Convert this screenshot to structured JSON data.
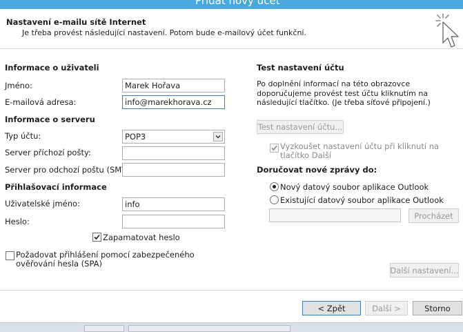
{
  "window": {
    "title": "Přidat nový účet"
  },
  "header": {
    "title": "Nastavení e-mailu sítě Internet",
    "subtitle": "Je třeba provést následující nastavení. Potom bude e-mailový účet funkční."
  },
  "user_info": {
    "heading": "Informace o uživateli",
    "name_label": "Jméno:",
    "name_value": "Marek Hořava",
    "email_label": "E-mailová adresa:",
    "email_value": "info@marekhorava.cz"
  },
  "server_info": {
    "heading": "Informace o serveru",
    "account_type_label": "Typ účtu:",
    "account_type_value": "POP3",
    "incoming_label": "Server příchozí pošty:",
    "incoming_value": "",
    "outgoing_label": "Server pro odchozí poštu (SMTP):",
    "outgoing_value": ""
  },
  "login_info": {
    "heading": "Přihlašovací informace",
    "username_label": "Uživatelské jméno:",
    "username_value": "info",
    "password_label": "Heslo:",
    "password_value": "",
    "remember_label": "Zapamatovat heslo",
    "remember_checked": true,
    "spa_label": "Požadovat přihlášení pomocí zabezpečeného ověřování hesla (SPA)",
    "spa_checked": false
  },
  "test": {
    "heading": "Test nastavení účtu",
    "description": "Po doplnění informací na této obrazovce doporučujeme provést test účtu kliknutím na následující tlačítko. (Je třeba síťové připojení.)",
    "button_label": "Test nastavení účtu...",
    "auto_test_label": "Vyzkoušet nastavení účtu při kliknutí na tlačítko Další",
    "auto_test_checked": true
  },
  "deliver": {
    "heading": "Doručovat nové zprávy do:",
    "option_new": "Nový datový soubor aplikace Outlook",
    "option_existing": "Existující datový soubor aplikace Outlook",
    "selected": "new",
    "path_value": "",
    "browse_label": "Procházet"
  },
  "buttons": {
    "more_settings": "Další nastavení...",
    "back": "< Zpět",
    "next": "Další >",
    "cancel": "Storno"
  },
  "colors": {
    "titlebar": "#49a8dc",
    "focus_border": "#3c7fb1"
  }
}
